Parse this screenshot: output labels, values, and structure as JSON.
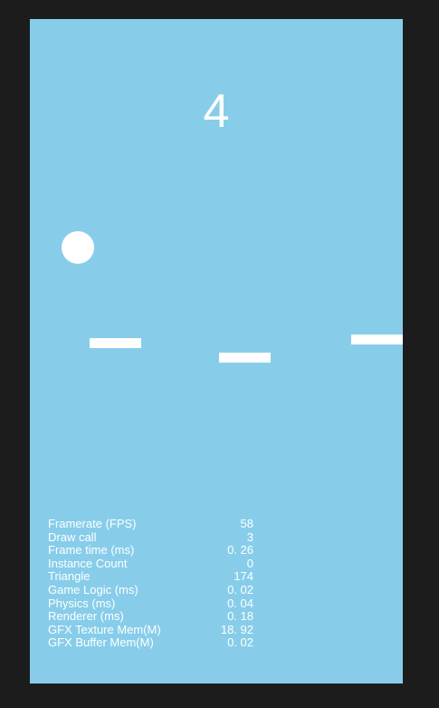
{
  "score": "4",
  "colors": {
    "background": "#1c1c1c",
    "sky": "#87cdea",
    "foreground": "#ffffff"
  },
  "stats": [
    {
      "label": "Framerate (FPS)",
      "value": "58"
    },
    {
      "label": "Draw call",
      "value": "3"
    },
    {
      "label": "Frame time (ms)",
      "value": "0. 26"
    },
    {
      "label": "Instance Count",
      "value": "0"
    },
    {
      "label": "Triangle",
      "value": "174"
    },
    {
      "label": "Game Logic (ms)",
      "value": "0. 02"
    },
    {
      "label": "Physics (ms)",
      "value": "0. 04"
    },
    {
      "label": "Renderer (ms)",
      "value": "0. 18"
    },
    {
      "label": "GFX Texture Mem(M)",
      "value": "18. 92"
    },
    {
      "label": "GFX Buffer Mem(M)",
      "value": "0. 02"
    }
  ]
}
